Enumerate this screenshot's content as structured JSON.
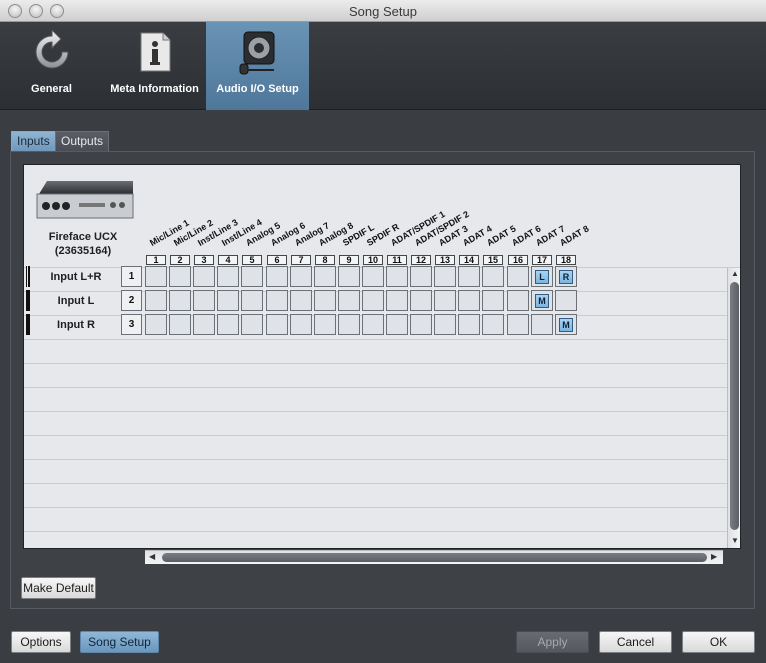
{
  "window": {
    "title": "Song Setup"
  },
  "top_tabs": [
    {
      "label": "General",
      "icon": "refresh-icon",
      "active": false
    },
    {
      "label": "Meta Information",
      "icon": "info-document-icon",
      "active": false
    },
    {
      "label": "Audio I/O Setup",
      "icon": "speaker-microphone-icon",
      "active": true
    }
  ],
  "sub_tabs": [
    {
      "label": "Inputs",
      "active": true
    },
    {
      "label": "Outputs",
      "active": false
    }
  ],
  "device": {
    "name": "Fireface UCX",
    "serial": "(23635164)",
    "icon": "audio-interface-icon"
  },
  "columns": [
    {
      "num": "1",
      "label": "Mic/Line 1"
    },
    {
      "num": "2",
      "label": "Mic/Line 2"
    },
    {
      "num": "3",
      "label": "Inst/Line 3"
    },
    {
      "num": "4",
      "label": "Inst/Line 4"
    },
    {
      "num": "5",
      "label": "Analog 5"
    },
    {
      "num": "6",
      "label": "Analog 6"
    },
    {
      "num": "7",
      "label": "Analog 7"
    },
    {
      "num": "8",
      "label": "Analog 8"
    },
    {
      "num": "9",
      "label": "SPDIF L"
    },
    {
      "num": "10",
      "label": "SPDIF R"
    },
    {
      "num": "11",
      "label": "ADAT/SPDIF 1"
    },
    {
      "num": "12",
      "label": "ADAT/SPDIF 2"
    },
    {
      "num": "13",
      "label": "ADAT 3"
    },
    {
      "num": "14",
      "label": "ADAT 4"
    },
    {
      "num": "15",
      "label": "ADAT 5"
    },
    {
      "num": "16",
      "label": "ADAT 6"
    },
    {
      "num": "17",
      "label": "ADAT 7"
    },
    {
      "num": "18",
      "label": "ADAT 8"
    }
  ],
  "rows": [
    {
      "num": "1",
      "label": "Input L+R",
      "stereo": true,
      "assignments": [
        {
          "col": 17,
          "text": "L"
        },
        {
          "col": 18,
          "text": "R"
        }
      ]
    },
    {
      "num": "2",
      "label": "Input L",
      "stereo": false,
      "assignments": [
        {
          "col": 17,
          "text": "M"
        }
      ]
    },
    {
      "num": "3",
      "label": "Input R",
      "stereo": false,
      "assignments": [
        {
          "col": 18,
          "text": "M"
        }
      ]
    }
  ],
  "buttons": {
    "make_default": "Make Default",
    "options": "Options",
    "song_setup": "Song Setup",
    "apply": "Apply",
    "cancel": "Cancel",
    "ok": "OK"
  },
  "colors": {
    "accent_blue": "#6f98bb",
    "assignment_blue": "#8cc3ea",
    "dark_background": "#3a3d41"
  }
}
